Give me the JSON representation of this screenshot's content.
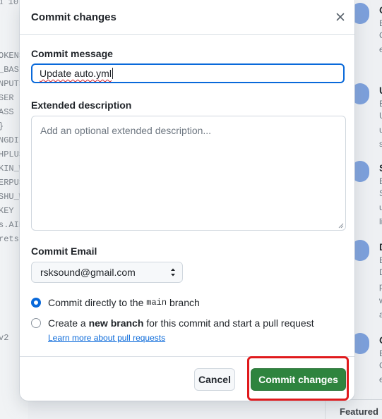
{
  "background": {
    "code_lines": [
      "OKENS",
      "_BASI",
      "NPUTS",
      "SER ]",
      "ASS ]",
      "}",
      "NGDI",
      "HPLUS",
      "KIN_W",
      "ERPUS",
      "SHU_W",
      "KEY ]",
      "s.AID",
      "rets."
    ],
    "code_top": "ᥲ 10",
    "code_bottom": "v2",
    "cards": [
      {
        "letter": "C",
        "sub": "E",
        "lines": [
          "C",
          "e"
        ]
      },
      {
        "letter": "U",
        "sub": "E",
        "lines": [
          "U",
          "u",
          "s"
        ]
      },
      {
        "letter": "S",
        "sub": "E",
        "lines": [
          "S",
          "u",
          "li"
        ]
      },
      {
        "letter": "D",
        "sub": "E",
        "lines": [
          "D",
          "p",
          "w",
          "a"
        ]
      },
      {
        "letter": "C",
        "sub": "E",
        "lines": [
          "C",
          "e"
        ]
      }
    ],
    "featured": "Featured"
  },
  "modal": {
    "title": "Commit changes",
    "close_icon": "×",
    "commit_message_label": "Commit message",
    "commit_message_value": "Update auto.yml",
    "extended_description_label": "Extended description",
    "extended_description_placeholder": "Add an optional extended description...",
    "commit_email_label": "Commit Email",
    "commit_email_value": "rsksound@gmail.com",
    "option_direct": {
      "prefix": "Commit directly to the ",
      "branch": "main",
      "suffix": " branch",
      "checked": true
    },
    "option_new_branch": {
      "prefix": "Create a ",
      "bold": "new branch",
      "suffix": " for this commit and start a pull request",
      "checked": false
    },
    "learn_more": "Learn more about pull requests",
    "cancel_label": "Cancel",
    "commit_label": "Commit changes"
  },
  "colors": {
    "accent_blue": "#0969da",
    "commit_green": "#2e843e",
    "highlight_red": "#e0191c"
  }
}
